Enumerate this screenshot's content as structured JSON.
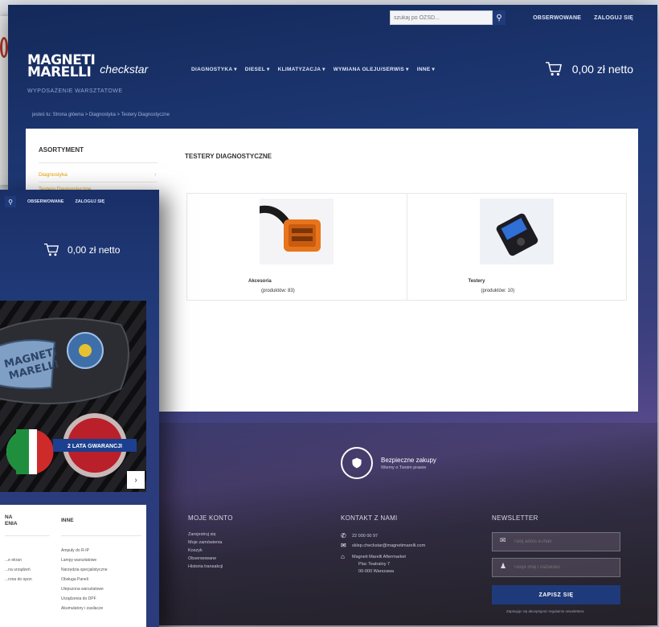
{
  "topbar": {
    "search_placeholder": "szukaj po OZSD...",
    "search_icon": "search-icon",
    "links": [
      "OBSERWOWANE",
      "ZALOGUJ SIĘ"
    ]
  },
  "logo": {
    "brand_line1": "MAGNETI",
    "brand_line2": "MARELLI",
    "sub_brand": "checkstar",
    "tagline": "WYPOSAŻENIE WARSZTATOWE"
  },
  "nav": {
    "items": [
      "DIAGNOSTYKA ▾",
      "DIESEL ▾",
      "KLIMATYZACJA ▾",
      "WYMIANA OLEJU/SERWIS ▾",
      "INNE ▾"
    ]
  },
  "cart": {
    "amount": "0,00 zł netto",
    "icon": "cart-icon"
  },
  "breadcrumb": "jesteś tu: Strona główna > Diagnostyka > Testery Diagnostyczne",
  "sidebar": {
    "title": "ASORTYMENT",
    "items": [
      "Diagnostyka",
      "Testery Diagnostyczne"
    ]
  },
  "content": {
    "title": "TESTERY DIAGNOSTYCZNE",
    "products": [
      {
        "name": "Akcesoria",
        "count": "(produktów: 83)"
      },
      {
        "name": "Testery",
        "count": "(produktów: 10)"
      }
    ]
  },
  "secure": {
    "title": "Bezpieczne zakupy",
    "subtitle": "Wiemy o Twoim prawie",
    "icon": "shield-icon"
  },
  "footer": {
    "account": {
      "title": "MOJE KONTO",
      "links": [
        "Zarejestruj się",
        "Moje zamówienia",
        "Koszyk",
        "Obserwowane",
        "Historia transakcji"
      ]
    },
    "contact": {
      "title": "KONTAKT Z NAMI",
      "phone": "22 000 00 97",
      "email": "sklep.checkstar@magnetimarelli.com",
      "address": [
        "Magneti Marelli Aftermarket",
        "Plac Teatralny 7",
        "00-000 Warszawa"
      ]
    },
    "newsletter": {
      "title": "NEWSLETTER",
      "email_placeholder": "Twój adres e-mail",
      "name_placeholder": "Twoje imię i nazwisko",
      "submit_label": "ZAPISZ SIĘ",
      "note": "Zapisując się akceptujesz regulamin newslettera"
    }
  },
  "front": {
    "links": [
      "OBSERWOWANE",
      "ZALOGUJ SIĘ"
    ],
    "cart_amount": "0,00 zł netto",
    "banner_badge": "2 LATA GWARANCJI",
    "banner_brand1": "MAGNETI",
    "banner_brand2": "MARELLI",
    "columns": [
      {
        "title_line1": "NA",
        "title_line2": "ENIA",
        "links": [
          "...e ekran",
          "...na urządzeń",
          "...rona do opon"
        ]
      },
      {
        "title_line1": "INNE",
        "title_line2": "",
        "links": [
          "Ampuły do R-IP",
          "Lampy warsztatowe",
          "Narzędzia specjalistyczne",
          "Obsługa Paneli",
          "Ulepszona warsztatowe",
          "Urządzenia do DPF",
          "Akumulatory i zasilacze"
        ]
      }
    ]
  },
  "colors": {
    "brand_navy": "#1e3a7a",
    "accent_orange": "#e3a100"
  }
}
